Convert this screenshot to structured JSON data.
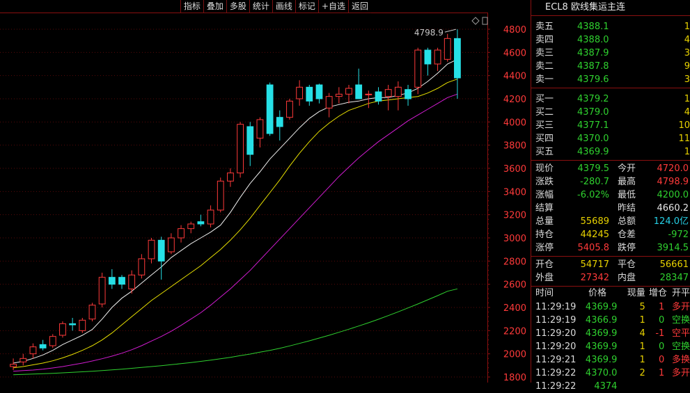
{
  "toolbar": {
    "buttons": [
      "指标",
      "叠加",
      "多股",
      "统计",
      "画线",
      "标记",
      "+自选",
      "返回"
    ]
  },
  "title": {
    "name": "ECL8",
    "desc": "欧线集运主连"
  },
  "orderbook": {
    "asks": [
      {
        "label": "卖五",
        "price": "4388.1",
        "vol": "1"
      },
      {
        "label": "卖四",
        "price": "4388.0",
        "vol": "4"
      },
      {
        "label": "卖三",
        "price": "4387.9",
        "vol": "3"
      },
      {
        "label": "卖二",
        "price": "4387.8",
        "vol": "9"
      },
      {
        "label": "卖一",
        "price": "4379.6",
        "vol": "3"
      }
    ],
    "bids": [
      {
        "label": "买一",
        "price": "4379.2",
        "vol": "1"
      },
      {
        "label": "买二",
        "price": "4379.0",
        "vol": "4"
      },
      {
        "label": "买三",
        "price": "4377.1",
        "vol": "10"
      },
      {
        "label": "买四",
        "price": "4370.0",
        "vol": "11"
      },
      {
        "label": "买五",
        "price": "4369.9",
        "vol": "1"
      }
    ]
  },
  "stats": [
    {
      "k": "现价",
      "v": "4379.5",
      "vc": "green",
      "k2": "今开",
      "v2": "4720.0",
      "v2c": "red"
    },
    {
      "k": "涨跌",
      "v": "-280.7",
      "vc": "green",
      "k2": "最高",
      "v2": "4798.9",
      "v2c": "red"
    },
    {
      "k": "涨幅",
      "v": "-6.02%",
      "vc": "green",
      "k2": "最低",
      "v2": "4200.0",
      "v2c": "green"
    },
    {
      "k": "结算",
      "v": "",
      "vc": "white",
      "k2": "昨结",
      "v2": "4660.2",
      "v2c": "white"
    },
    {
      "k": "总量",
      "v": "55689",
      "vc": "yellow",
      "k2": "总额",
      "v2": "124.0亿",
      "v2c": "cyan"
    },
    {
      "k": "持仓",
      "v": "44245",
      "vc": "yellow",
      "k2": "仓差",
      "v2": "-972",
      "v2c": "green"
    },
    {
      "k": "涨停",
      "v": "5405.8",
      "vc": "red",
      "k2": "跌停",
      "v2": "3914.5",
      "v2c": "green"
    }
  ],
  "stats2": [
    {
      "k": "开仓",
      "v": "54717",
      "vc": "yellow",
      "k2": "平仓",
      "v2": "56661",
      "v2c": "yellow"
    },
    {
      "k": "外盘",
      "v": "27342",
      "vc": "red",
      "k2": "内盘",
      "v2": "28347",
      "v2c": "green"
    }
  ],
  "ticks": {
    "headers": [
      "时间",
      "价格",
      "现量",
      "增仓",
      "开平"
    ],
    "rows": [
      {
        "time": "11:29:19",
        "price": "4369.9",
        "vol": "5",
        "oi": "1",
        "oic": "red",
        "type": "多开",
        "tc": "red"
      },
      {
        "time": "11:29:19",
        "price": "4366.9",
        "vol": "1",
        "oi": "0",
        "oic": "green",
        "type": "空换",
        "tc": "green"
      },
      {
        "time": "11:29:20",
        "price": "4369.9",
        "vol": "4",
        "oi": "-1",
        "oic": "red",
        "type": "空平",
        "tc": "red"
      },
      {
        "time": "11:29:20",
        "price": "4369.9",
        "vol": "1",
        "oi": "0",
        "oic": "green",
        "type": "空换",
        "tc": "green"
      },
      {
        "time": "11:29:21",
        "price": "4369.9",
        "vol": "1",
        "oi": "0",
        "oic": "red",
        "type": "多换",
        "tc": "red"
      },
      {
        "time": "11:29:22",
        "price": "4370.0",
        "vol": "2",
        "oi": "1",
        "oic": "red",
        "type": "多开",
        "tc": "red"
      },
      {
        "time": "11:29:22",
        "price": "4374",
        "vol": "",
        "oi": "",
        "oic": "red",
        "type": "",
        "tc": "red"
      }
    ]
  },
  "chart_data": {
    "type": "candlestick",
    "y_ticks": [
      "4800",
      "4600",
      "4400",
      "4200",
      "4000",
      "3800",
      "3600",
      "3400",
      "3200",
      "3000",
      "2800",
      "2600",
      "2400",
      "2200",
      "2000",
      "1800"
    ],
    "ylim": [
      1800,
      4800
    ],
    "high_label": "4798.9",
    "candles": [
      {
        "o": 1890,
        "h": 1960,
        "l": 1860,
        "c": 1910
      },
      {
        "o": 1930,
        "h": 2000,
        "l": 1900,
        "c": 1960
      },
      {
        "o": 2000,
        "h": 2090,
        "l": 1960,
        "c": 2060
      },
      {
        "o": 2080,
        "h": 2120,
        "l": 2030,
        "c": 2050
      },
      {
        "o": 2070,
        "h": 2170,
        "l": 2050,
        "c": 2150
      },
      {
        "o": 2160,
        "h": 2280,
        "l": 2140,
        "c": 2260
      },
      {
        "o": 2260,
        "h": 2310,
        "l": 2200,
        "c": 2250
      },
      {
        "o": 2200,
        "h": 2310,
        "l": 2180,
        "c": 2290
      },
      {
        "o": 2300,
        "h": 2440,
        "l": 2280,
        "c": 2420
      },
      {
        "o": 2430,
        "h": 2700,
        "l": 2400,
        "c": 2660
      },
      {
        "o": 2660,
        "h": 2730,
        "l": 2560,
        "c": 2600
      },
      {
        "o": 2660,
        "h": 2680,
        "l": 2560,
        "c": 2600
      },
      {
        "o": 2560,
        "h": 2720,
        "l": 2520,
        "c": 2680
      },
      {
        "o": 2680,
        "h": 2860,
        "l": 2650,
        "c": 2820
      },
      {
        "o": 2820,
        "h": 3000,
        "l": 2780,
        "c": 2980
      },
      {
        "o": 2980,
        "h": 3010,
        "l": 2640,
        "c": 2800
      },
      {
        "o": 2880,
        "h": 3040,
        "l": 2860,
        "c": 3000
      },
      {
        "o": 3000,
        "h": 3110,
        "l": 2960,
        "c": 3080
      },
      {
        "o": 3080,
        "h": 3140,
        "l": 3040,
        "c": 3120
      },
      {
        "o": 3140,
        "h": 3200,
        "l": 3100,
        "c": 3120
      },
      {
        "o": 3120,
        "h": 3280,
        "l": 3090,
        "c": 3240
      },
      {
        "o": 3240,
        "h": 3520,
        "l": 3220,
        "c": 3490
      },
      {
        "o": 3490,
        "h": 3600,
        "l": 3440,
        "c": 3560
      },
      {
        "o": 3560,
        "h": 4000,
        "l": 3520,
        "c": 3980
      },
      {
        "o": 3960,
        "h": 4000,
        "l": 3620,
        "c": 3720
      },
      {
        "o": 3860,
        "h": 4040,
        "l": 3780,
        "c": 4020
      },
      {
        "o": 4320,
        "h": 4340,
        "l": 3880,
        "c": 3900
      },
      {
        "o": 4040,
        "h": 4100,
        "l": 3840,
        "c": 3960
      },
      {
        "o": 4040,
        "h": 4200,
        "l": 4020,
        "c": 4180
      },
      {
        "o": 4200,
        "h": 4360,
        "l": 4140,
        "c": 4300
      },
      {
        "o": 4300,
        "h": 4320,
        "l": 4140,
        "c": 4180
      },
      {
        "o": 4320,
        "h": 4330,
        "l": 4160,
        "c": 4200
      },
      {
        "o": 4120,
        "h": 4250,
        "l": 4040,
        "c": 4220
      },
      {
        "o": 4220,
        "h": 4300,
        "l": 4160,
        "c": 4240
      },
      {
        "o": 4240,
        "h": 4320,
        "l": 4160,
        "c": 4290
      },
      {
        "o": 4320,
        "h": 4460,
        "l": 4200,
        "c": 4200
      },
      {
        "o": 4240,
        "h": 4270,
        "l": 4120,
        "c": 4240
      },
      {
        "o": 4260,
        "h": 4300,
        "l": 4150,
        "c": 4180
      },
      {
        "o": 4220,
        "h": 4320,
        "l": 4100,
        "c": 4280
      },
      {
        "o": 4220,
        "h": 4350,
        "l": 4100,
        "c": 4300
      },
      {
        "o": 4280,
        "h": 4320,
        "l": 4140,
        "c": 4200
      },
      {
        "o": 4300,
        "h": 4640,
        "l": 4240,
        "c": 4620
      },
      {
        "o": 4620,
        "h": 4640,
        "l": 4400,
        "c": 4500
      },
      {
        "o": 4500,
        "h": 4640,
        "l": 4440,
        "c": 4620
      },
      {
        "o": 4540,
        "h": 4760,
        "l": 4520,
        "c": 4720
      },
      {
        "o": 4720,
        "h": 4799,
        "l": 4200,
        "c": 4380
      }
    ],
    "ma_white": [
      1920,
      1935,
      1960,
      1990,
      2030,
      2080,
      2120,
      2160,
      2210,
      2300,
      2400,
      2480,
      2540,
      2610,
      2680,
      2750,
      2830,
      2890,
      2950,
      3000,
      3050,
      3110,
      3220,
      3350,
      3470,
      3570,
      3680,
      3770,
      3860,
      3950,
      4030,
      4090,
      4130,
      4150,
      4170,
      4180,
      4200,
      4210,
      4210,
      4230,
      4250,
      4290,
      4350,
      4420,
      4500,
      4540
    ],
    "ma_yellow": [
      1880,
      1890,
      1905,
      1920,
      1940,
      1965,
      1995,
      2030,
      2070,
      2120,
      2180,
      2250,
      2320,
      2390,
      2460,
      2520,
      2580,
      2640,
      2700,
      2760,
      2830,
      2900,
      2980,
      3070,
      3170,
      3280,
      3390,
      3500,
      3620,
      3730,
      3830,
      3920,
      3990,
      4050,
      4100,
      4130,
      4160,
      4180,
      4190,
      4200,
      4210,
      4220,
      4250,
      4290,
      4340,
      4370
    ],
    "ma_magenta": [
      1850,
      1855,
      1860,
      1868,
      1878,
      1890,
      1905,
      1920,
      1938,
      1958,
      1980,
      2005,
      2035,
      2070,
      2110,
      2150,
      2195,
      2245,
      2300,
      2355,
      2420,
      2490,
      2560,
      2640,
      2720,
      2810,
      2900,
      2990,
      3080,
      3170,
      3260,
      3350,
      3440,
      3530,
      3610,
      3690,
      3760,
      3830,
      3890,
      3950,
      4010,
      4060,
      4110,
      4160,
      4210,
      4240
    ],
    "ma_green": [
      1820,
      1822,
      1825,
      1828,
      1832,
      1836,
      1840,
      1845,
      1850,
      1856,
      1862,
      1868,
      1875,
      1882,
      1890,
      1898,
      1906,
      1915,
      1925,
      1935,
      1946,
      1958,
      1970,
      1984,
      1998,
      2014,
      2030,
      2048,
      2068,
      2090,
      2112,
      2136,
      2160,
      2186,
      2212,
      2240,
      2268,
      2298,
      2330,
      2362,
      2396,
      2430,
      2466,
      2502,
      2540,
      2560
    ]
  }
}
